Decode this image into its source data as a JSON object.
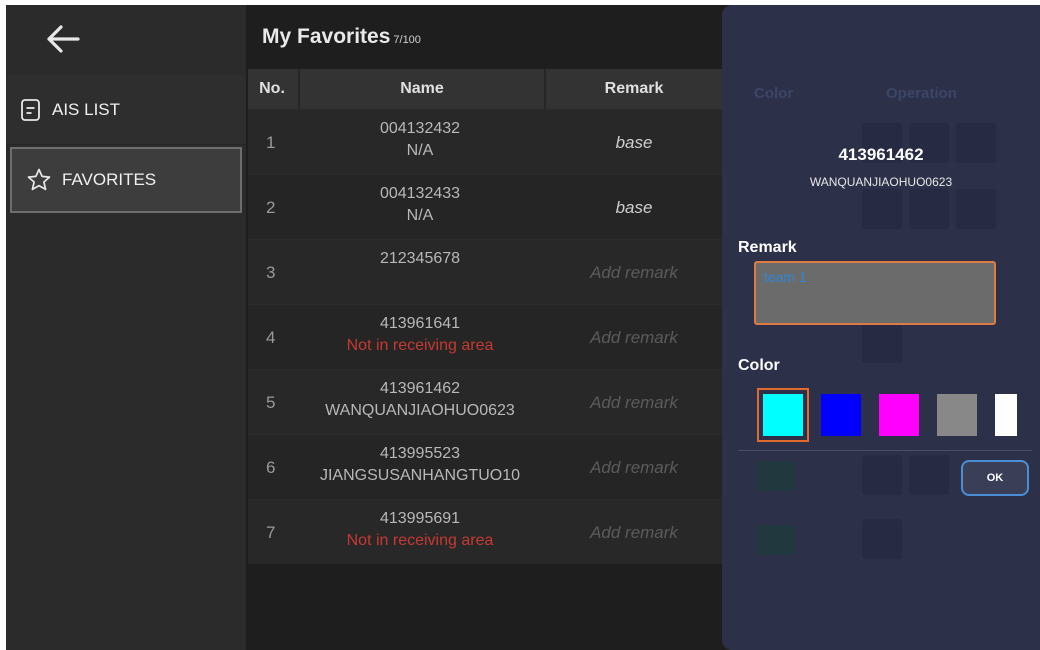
{
  "sidebar": {
    "back_icon": "arrow-left-icon",
    "items": [
      {
        "label": "AIS LIST",
        "icon": "document-icon"
      },
      {
        "label": "FAVORITES",
        "icon": "star-icon"
      }
    ]
  },
  "main": {
    "title": "My Favorites",
    "count": "7/100",
    "columns": [
      "No.",
      "Name",
      "Remark"
    ],
    "rows": [
      {
        "no": "1",
        "id": "004132432",
        "name": "N/A",
        "remark": "base"
      },
      {
        "no": "2",
        "id": "004132433",
        "name": "N/A",
        "remark": "base"
      },
      {
        "no": "3",
        "id": "212345678",
        "name": "",
        "remark": "Add remark"
      },
      {
        "no": "4",
        "id": "413961641",
        "name": "Not in receiving area",
        "remark": "Add remark"
      },
      {
        "no": "5",
        "id": "413961462",
        "name": "WANQUANJIAOHUO0623",
        "remark": "Add remark"
      },
      {
        "no": "6",
        "id": "413995523",
        "name": "JIANGSUSANHANGTUO10",
        "remark": "Add remark"
      },
      {
        "no": "7",
        "id": "413995691",
        "name": "Not in receiving area",
        "remark": "Add remark"
      }
    ],
    "background_columns": [
      "Color",
      "Operation"
    ]
  },
  "panel": {
    "mmsi": "413961462",
    "ship_name": "WANQUANJIAOHUO0623",
    "remark_label": "Remark",
    "remark_value": "team 1",
    "color_label": "Color",
    "colors": [
      "#00ffff",
      "#0000ff",
      "#ff00ff",
      "#888888",
      "#ffffff"
    ],
    "selected_color": "#00ffff",
    "ok_label": "OK"
  },
  "theme": {
    "background": "#1e1e1e",
    "sidebar_bg": "#2b2b2b",
    "panel_bg": "#2c3048",
    "accent_orange": "#e07a43",
    "warning_red": "#c43a33",
    "button_border": "#4a8ed6"
  }
}
